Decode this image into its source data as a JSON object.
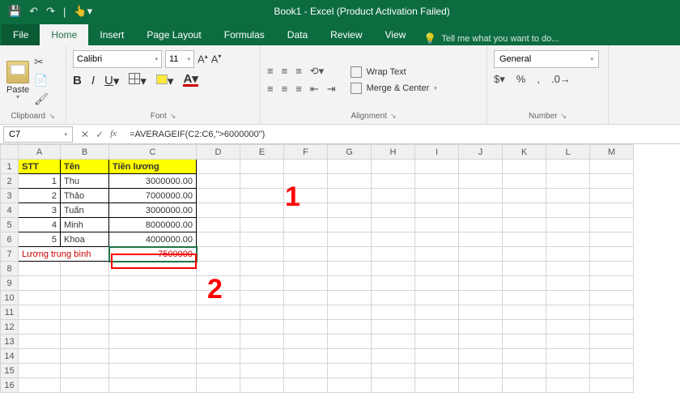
{
  "titlebar": {
    "title": "Book1 - Excel (Product Activation Failed)"
  },
  "tabs": {
    "file": "File",
    "home": "Home",
    "insert": "Insert",
    "pageLayout": "Page Layout",
    "formulas": "Formulas",
    "data": "Data",
    "review": "Review",
    "view": "View",
    "tellme": "Tell me what you want to do..."
  },
  "ribbon": {
    "clipboard": {
      "paste": "Paste",
      "label": "Clipboard"
    },
    "font": {
      "name": "Calibri",
      "size": "11",
      "label": "Font"
    },
    "alignment": {
      "wrap": "Wrap Text",
      "merge": "Merge & Center",
      "label": "Alignment"
    },
    "number": {
      "format": "General",
      "label": "Number"
    }
  },
  "fxbar": {
    "ref": "C7",
    "formula": "=AVERAGEIF(C2:C6,\">6000000\")"
  },
  "columns": [
    "A",
    "B",
    "C",
    "D",
    "E",
    "F",
    "G",
    "H",
    "I",
    "J",
    "K",
    "L",
    "M"
  ],
  "rows": [
    "1",
    "2",
    "3",
    "4",
    "5",
    "6",
    "7",
    "8",
    "9",
    "10",
    "11",
    "12",
    "13",
    "14",
    "15",
    "16"
  ],
  "sheet": {
    "hdr": {
      "a": "STT",
      "b": "Tên",
      "c": "Tiền lương"
    },
    "r2": {
      "a": "1",
      "b": "Thu",
      "c": "3000000.00"
    },
    "r3": {
      "a": "2",
      "b": "Thảo",
      "c": "7000000.00"
    },
    "r4": {
      "a": "3",
      "b": "Tuấn",
      "c": "3000000.00"
    },
    "r5": {
      "a": "4",
      "b": "Minh",
      "c": "8000000.00"
    },
    "r6": {
      "a": "5",
      "b": "Khoa",
      "c": "4000000.00"
    },
    "r7": {
      "ab": "Lương trung bình",
      "c": "7500000"
    }
  },
  "anno": {
    "one": "1",
    "two": "2"
  }
}
